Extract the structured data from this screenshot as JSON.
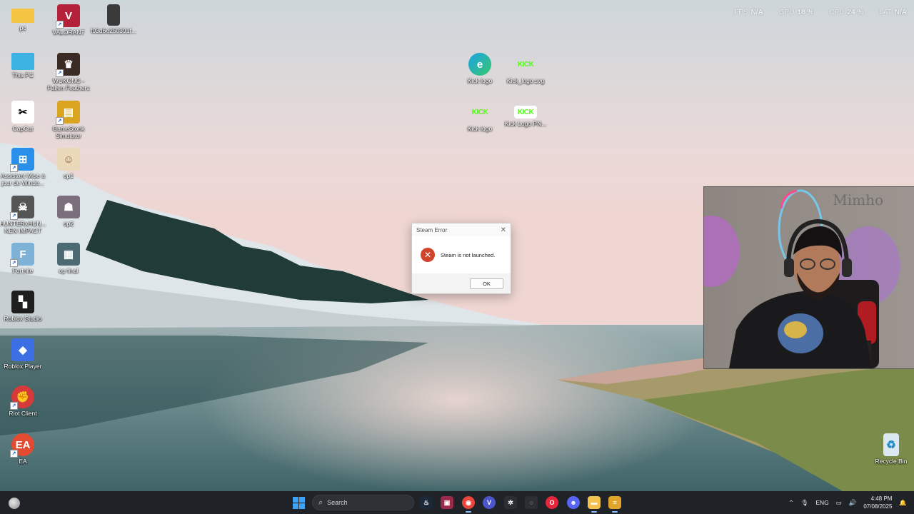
{
  "perf": [
    {
      "key": "FPS",
      "value": "N/A"
    },
    {
      "key": "GPU",
      "value": "18 %"
    },
    {
      "key": "CPU",
      "value": "24 %"
    },
    {
      "key": "LAT",
      "value": "N/A"
    }
  ],
  "desktop": {
    "icons": [
      {
        "label": "pc",
        "icon": "folder-icon",
        "color": "#f4c542"
      },
      {
        "label": "VALORANT",
        "icon": "valorant-icon",
        "color": "#b3213a"
      },
      {
        "label": "f93d6e250391f...",
        "icon": "image-file-icon",
        "color": "#3a3a3a"
      },
      {
        "label": "This PC",
        "icon": "monitor-icon",
        "color": "#3db3e3"
      },
      {
        "label": "WUKONG - Fallen Feathers",
        "icon": "game-icon",
        "color": "#3a2c25"
      },
      {
        "label": "CapCut",
        "icon": "capcut-icon",
        "color": "#ffffff"
      },
      {
        "label": "GameStonk Simulator",
        "icon": "game-icon",
        "color": "#d9a520"
      },
      {
        "label": "Assistant Mise à jour de Windo...",
        "icon": "windows-icon",
        "color": "#2a8fe8"
      },
      {
        "label": "op1",
        "icon": "image-file-icon",
        "color": "#e9d9b8"
      },
      {
        "label": "HUNTERxHUN... NEN IMPACT",
        "icon": "game-icon",
        "color": "#555555"
      },
      {
        "label": "op2",
        "icon": "image-file-icon",
        "color": "#7b6e7d"
      },
      {
        "label": "Fortnite",
        "icon": "fortnite-icon",
        "color": "#7eb1d6"
      },
      {
        "label": "op final",
        "icon": "image-file-icon",
        "color": "#4d6a72"
      },
      {
        "label": "Roblox Studio",
        "icon": "roblox-studio-icon",
        "color": "#1e1e1e"
      },
      {
        "label": "Roblox Player",
        "icon": "roblox-icon",
        "color": "#3b6fe3"
      },
      {
        "label": "Riot Client",
        "icon": "riot-icon",
        "color": "#d63a3a"
      },
      {
        "label": "EA",
        "icon": "ea-icon",
        "color": "#e24a32"
      },
      {
        "label": "Kick logo",
        "icon": "edge-icon",
        "color": "#1aa3e8"
      },
      {
        "label": "Kick_logo.svg",
        "icon": "kick-icon",
        "color": "#53fc18"
      },
      {
        "label": "Kick logo",
        "icon": "kick-icon",
        "color": "#53fc18"
      },
      {
        "label": "Kick Logo PN...",
        "icon": "kick-icon",
        "color": "#53fc18"
      },
      {
        "label": "Recycle Bin",
        "icon": "recycle-bin-icon",
        "color": "#dbe8f0"
      }
    ],
    "kick_text": "KICK"
  },
  "dialog": {
    "title": "Steam Error",
    "message": "Steam is not launched.",
    "ok_label": "OK"
  },
  "webcam": {
    "watermark": "Mimho"
  },
  "taskbar": {
    "search_label": "Search",
    "apps": [
      {
        "name": "steam",
        "icon": "steam-icon",
        "color": "#1b2838",
        "glyph": "♨"
      },
      {
        "name": "app",
        "icon": "app-icon",
        "color": "#9e2a4b",
        "glyph": "▣"
      },
      {
        "name": "chrome",
        "icon": "chrome-icon",
        "color": "#e8453c",
        "glyph": "◉"
      },
      {
        "name": "vpn",
        "icon": "v-icon",
        "color": "#4b55c9",
        "glyph": "V"
      },
      {
        "name": "chatgpt",
        "icon": "chatgpt-icon",
        "color": "#2b2f33",
        "glyph": "✲"
      },
      {
        "name": "app2",
        "icon": "circle-app-icon",
        "color": "#2b2f33",
        "glyph": "◌"
      },
      {
        "name": "opera",
        "icon": "opera-icon",
        "color": "#e3263b",
        "glyph": "O"
      },
      {
        "name": "discord",
        "icon": "discord-icon",
        "color": "#5865f2",
        "glyph": "☻"
      },
      {
        "name": "explorer",
        "icon": "folder-icon",
        "color": "#f2c14e",
        "glyph": "▬"
      },
      {
        "name": "app3",
        "icon": "burger-app-icon",
        "color": "#e0a52a",
        "glyph": "≡"
      }
    ],
    "tray": {
      "language": "ENG",
      "time": "4:48 PM",
      "date": "07/08/2025"
    }
  }
}
